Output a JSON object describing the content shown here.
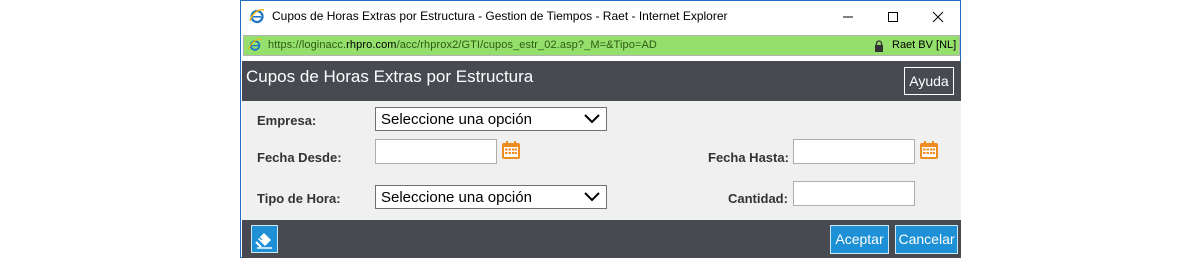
{
  "window": {
    "title": "Cupos de Horas Extras por Estructura - Gestion de Tiempos - Raet - Internet Explorer",
    "icons": [
      "ie-logo-icon",
      "minimize-icon",
      "maximize-icon",
      "close-icon"
    ]
  },
  "address": {
    "url_prefix": "https://loginacc.",
    "url_domain": "rhpro.com",
    "url_path": "/acc/rhprox2/GTI/cupos_estr_02.asp?_M=&Tipo=AD",
    "certificate": "Raet BV [NL]",
    "bar_color": "#95e06c"
  },
  "header": {
    "title": "Cupos de Horas Extras por Estructura",
    "help_label": "Ayuda"
  },
  "form": {
    "empresa_label": "Empresa:",
    "empresa_value": "Seleccione una opción",
    "fecha_desde_label": "Fecha Desde:",
    "fecha_desde_value": "",
    "fecha_hasta_label": "Fecha Hasta:",
    "fecha_hasta_value": "",
    "tipo_hora_label": "Tipo de Hora:",
    "tipo_hora_value": "Seleccione una opción",
    "cantidad_label": "Cantidad:",
    "cantidad_value": ""
  },
  "footer": {
    "accept_label": "Aceptar",
    "cancel_label": "Cancelar"
  },
  "colors": {
    "header_bg": "#484a51",
    "button_bg": "#1e90d6",
    "calendar_accent": "#f08c1e"
  }
}
